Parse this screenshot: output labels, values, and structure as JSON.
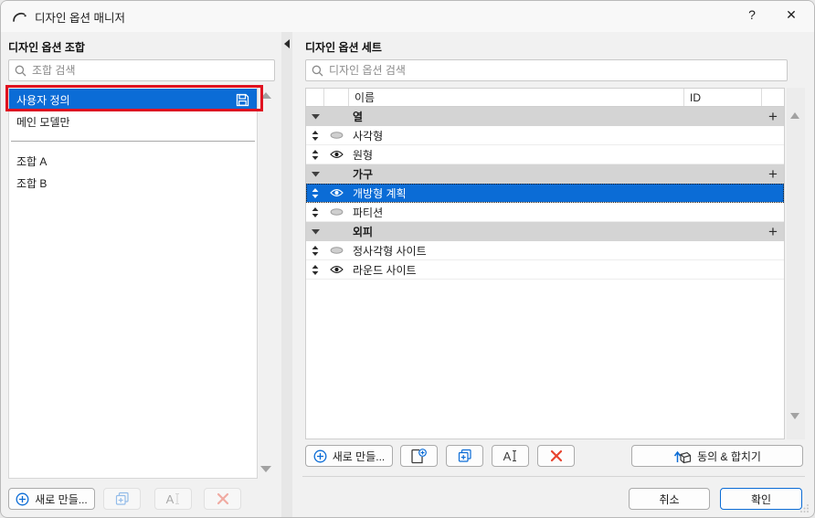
{
  "window": {
    "title": "디자인 옵션 매니저",
    "help_glyph": "?",
    "close_glyph": "✕"
  },
  "left_panel": {
    "title": "디자인 옵션 조합",
    "search_placeholder": "조합 검색",
    "items": [
      {
        "label": "사용자 정의",
        "selected": true,
        "has_save_icon": true,
        "annotated_red": true
      },
      {
        "label": "메인 모델만",
        "selected": false
      },
      {
        "label": "조합 A",
        "selected": false
      },
      {
        "label": "조합 B",
        "selected": false
      }
    ],
    "buttons": {
      "new_label": "새로 만들...",
      "duplicate_enabled": false,
      "rename_enabled": false,
      "delete_enabled": false
    }
  },
  "right_panel": {
    "title": "디자인 옵션 세트",
    "search_placeholder": "디자인 옵션 검색",
    "table": {
      "columns": {
        "name": "이름",
        "id": "ID"
      },
      "rows": [
        {
          "type": "group",
          "name": "열",
          "expanded": true
        },
        {
          "type": "option",
          "name": "사각형",
          "visible": false,
          "selected": false
        },
        {
          "type": "option",
          "name": "원형",
          "visible": true,
          "selected": false
        },
        {
          "type": "group",
          "name": "가구",
          "expanded": true
        },
        {
          "type": "option",
          "name": "개방형 계획",
          "visible": true,
          "selected": true
        },
        {
          "type": "option",
          "name": "파티션",
          "visible": false,
          "selected": false
        },
        {
          "type": "group",
          "name": "외피",
          "expanded": true
        },
        {
          "type": "option",
          "name": "정사각형 사이트",
          "visible": false,
          "selected": false
        },
        {
          "type": "option",
          "name": "라운드 사이트",
          "visible": true,
          "selected": false
        }
      ],
      "group_add_glyph": "+"
    },
    "buttons": {
      "new_label": "새로 만들...",
      "rename_letter": "A",
      "accept_merge_label": "동의 & 합치기"
    }
  },
  "footer": {
    "cancel_label": "취소",
    "ok_label": "확인",
    "rename_letter": "A"
  },
  "colors": {
    "accent_blue": "#0b6cd6",
    "annotation_red": "#e01220",
    "group_row_bg": "#d4d4d4",
    "delete_red": "#e8432e",
    "ok_border": "#0b6cd6"
  }
}
